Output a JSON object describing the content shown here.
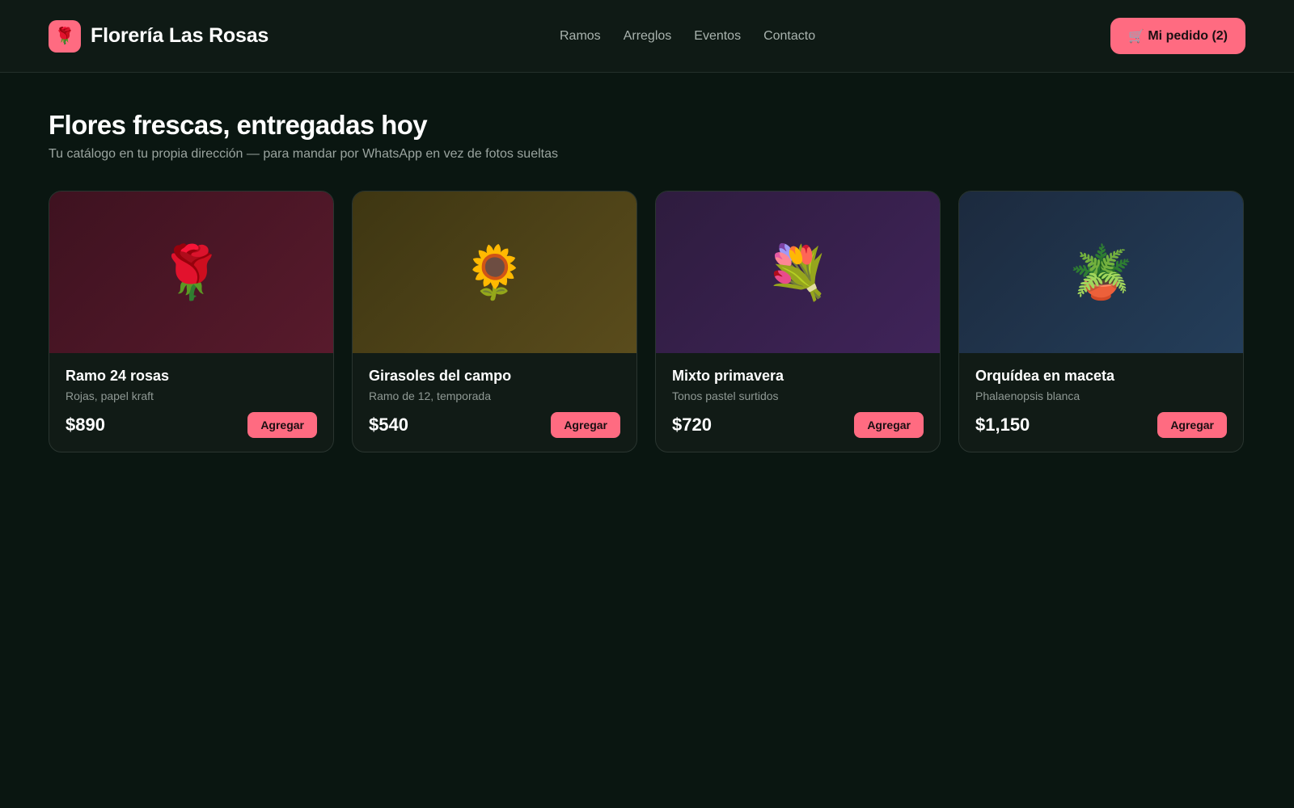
{
  "header": {
    "logo_icon": "🌹",
    "brand_name": "Florería Las Rosas",
    "nav": [
      {
        "label": "Ramos"
      },
      {
        "label": "Arreglos"
      },
      {
        "label": "Eventos"
      },
      {
        "label": "Contacto"
      }
    ],
    "cart": {
      "icon": "🛒",
      "label": "Mi pedido (2)"
    }
  },
  "hero": {
    "title": "Flores frescas, entregadas hoy",
    "subtitle": "Tu catálogo en tu propia dirección — para mandar por WhatsApp en vez de fotos sueltas"
  },
  "products": [
    {
      "icon": "🌹",
      "icon_name": "rose-icon",
      "name": "Ramo 24 rosas",
      "description": "Rojas, papel kraft",
      "price": "$890",
      "button": "Agregar",
      "gradient": [
        "#3e1220",
        "#581a2c"
      ]
    },
    {
      "icon": "🌻",
      "icon_name": "sunflower-icon",
      "name": "Girasoles del campo",
      "description": "Ramo de 12, temporada",
      "price": "$540",
      "button": "Agregar",
      "gradient": [
        "#3e3612",
        "#5a4c1c"
      ]
    },
    {
      "icon": "💐",
      "icon_name": "bouquet-icon",
      "name": "Mixto primavera",
      "description": "Tonos pastel surtidos",
      "price": "$720",
      "button": "Agregar",
      "gradient": [
        "#2e1c3e",
        "#40245a"
      ]
    },
    {
      "icon": "🪴",
      "icon_name": "potted-plant-icon",
      "name": "Orquídea en maceta",
      "description": "Phalaenopsis blanca",
      "price": "$1,150",
      "button": "Agregar",
      "gradient": [
        "#1c2a3e",
        "#243e5a"
      ]
    }
  ],
  "colors": {
    "accent": "#ff6b81",
    "background": "#0a1611",
    "header_bg": "#0f1a15"
  }
}
